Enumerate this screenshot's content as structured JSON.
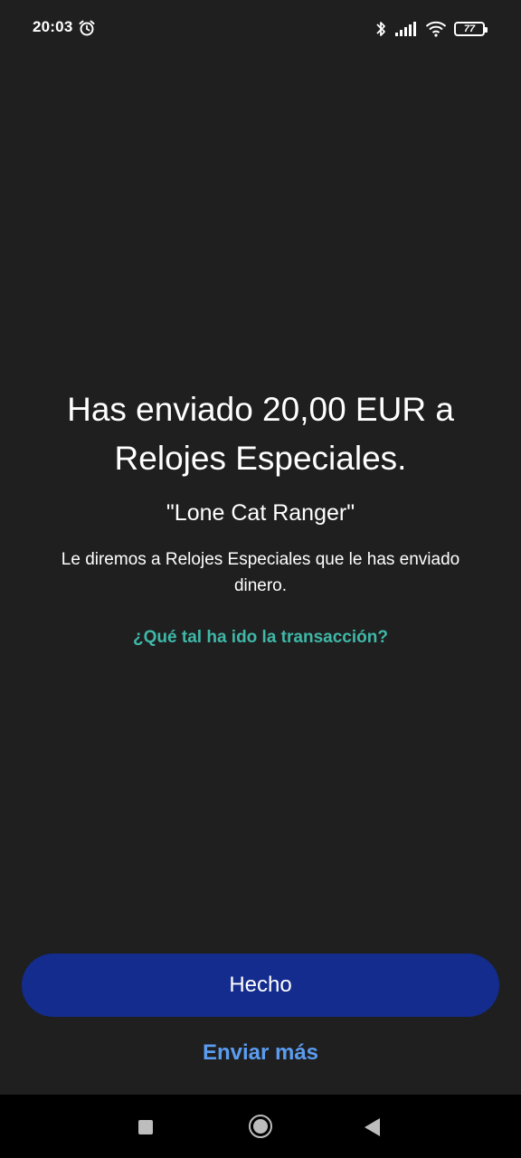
{
  "status_bar": {
    "time": "20:03",
    "battery_level": "77",
    "icons": [
      "alarm-icon",
      "bluetooth-icon",
      "signal-icon",
      "wifi-icon",
      "battery-icon"
    ]
  },
  "confirmation": {
    "headline": "Has enviado 20,00 EUR a Relojes Especiales.",
    "note": "\"Lone Cat Ranger\"",
    "info": "Le diremos a Relojes Especiales que le has enviado dinero.",
    "feedback_link": "¿Qué tal ha ido la transacción?"
  },
  "actions": {
    "done_label": "Hecho",
    "send_more_label": "Enviar más"
  },
  "nav_bar": {
    "icons": [
      "recent-apps-icon",
      "home-icon",
      "back-icon"
    ]
  },
  "colors": {
    "background": "#1f1f1f",
    "primary_button": "#142c8e",
    "link_teal": "#3fb8a8",
    "link_blue": "#5b9cf0"
  }
}
